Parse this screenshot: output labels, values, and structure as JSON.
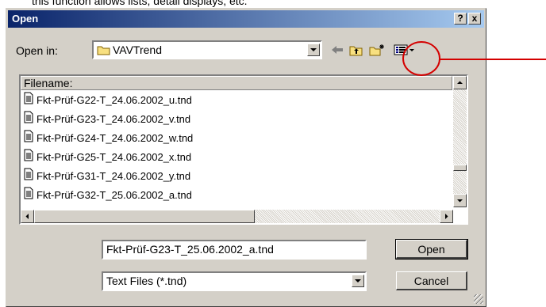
{
  "caption": "this function allows lists, detail displays, etc.",
  "window": {
    "title": "Open",
    "help_label": "?",
    "close_label": "x"
  },
  "look_in": {
    "label": "Open in:",
    "value": "VAVTrend"
  },
  "file_list": {
    "column_header": "Filename:",
    "items": [
      "Fkt-Prüf-G22-T_24.06.2002_u.tnd",
      "Fkt-Prüf-G23-T_24.06.2002_v.tnd",
      "Fkt-Prüf-G24-T_24.06.2002_w.tnd",
      "Fkt-Prüf-G25-T_24.06.2002_x.tnd",
      "Fkt-Prüf-G31-T_24.06.2002_y.tnd",
      "Fkt-Prüf-G32-T_25.06.2002_a.tnd"
    ]
  },
  "filename_value": "Fkt-Prüf-G23-T_25.06.2002_a.tnd",
  "filetype_value": "Text Files (*.tnd)",
  "buttons": {
    "open": "Open",
    "cancel": "Cancel"
  },
  "icons": {
    "back": "back-arrow-icon",
    "up": "up-folder-icon",
    "new_folder": "new-folder-icon",
    "view": "view-menu-icon"
  },
  "colors": {
    "title_start": "#0a246a",
    "title_end": "#a6caf0",
    "dialog_bg": "#d4d0c8",
    "annotation": "#d40000"
  }
}
